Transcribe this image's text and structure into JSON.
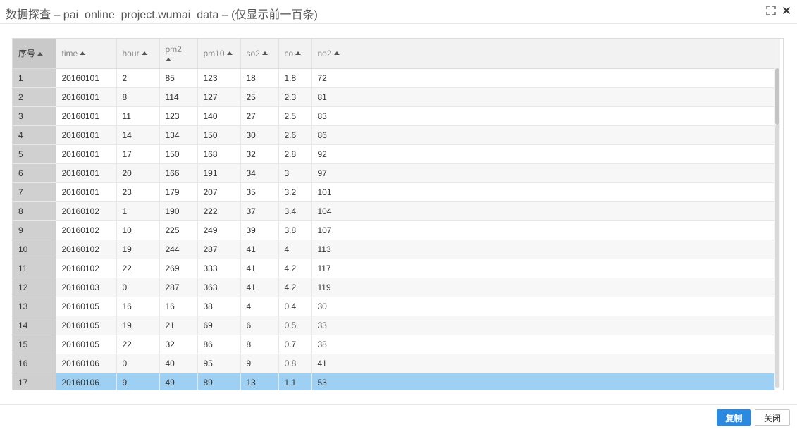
{
  "window": {
    "title": "数据探查 – pai_online_project.wumai_data – (仅显示前一百条)",
    "expand_icon": "expand-icon",
    "close_icon": "close-icon"
  },
  "table": {
    "columns": [
      "序号",
      "time",
      "hour",
      "pm2",
      "pm10",
      "so2",
      "co",
      "no2"
    ],
    "rows": [
      [
        "1",
        "20160101",
        "2",
        "85",
        "123",
        "18",
        "1.8",
        "72"
      ],
      [
        "2",
        "20160101",
        "8",
        "114",
        "127",
        "25",
        "2.3",
        "81"
      ],
      [
        "3",
        "20160101",
        "11",
        "123",
        "140",
        "27",
        "2.5",
        "83"
      ],
      [
        "4",
        "20160101",
        "14",
        "134",
        "150",
        "30",
        "2.6",
        "86"
      ],
      [
        "5",
        "20160101",
        "17",
        "150",
        "168",
        "32",
        "2.8",
        "92"
      ],
      [
        "6",
        "20160101",
        "20",
        "166",
        "191",
        "34",
        "3",
        "97"
      ],
      [
        "7",
        "20160101",
        "23",
        "179",
        "207",
        "35",
        "3.2",
        "101"
      ],
      [
        "8",
        "20160102",
        "1",
        "190",
        "222",
        "37",
        "3.4",
        "104"
      ],
      [
        "9",
        "20160102",
        "10",
        "225",
        "249",
        "39",
        "3.8",
        "107"
      ],
      [
        "10",
        "20160102",
        "19",
        "244",
        "287",
        "41",
        "4",
        "113"
      ],
      [
        "11",
        "20160102",
        "22",
        "269",
        "333",
        "41",
        "4.2",
        "117"
      ],
      [
        "12",
        "20160103",
        "0",
        "287",
        "363",
        "41",
        "4.2",
        "119"
      ],
      [
        "13",
        "20160105",
        "16",
        "16",
        "38",
        "4",
        "0.4",
        "30"
      ],
      [
        "14",
        "20160105",
        "19",
        "21",
        "69",
        "6",
        "0.5",
        "33"
      ],
      [
        "15",
        "20160105",
        "22",
        "32",
        "86",
        "8",
        "0.7",
        "38"
      ],
      [
        "16",
        "20160106",
        "0",
        "40",
        "95",
        "9",
        "0.8",
        "41"
      ],
      [
        "17",
        "20160106",
        "9",
        "49",
        "89",
        "13",
        "1.1",
        "53"
      ]
    ],
    "selected_row": "17",
    "sort_icon": "sort-asc-icon"
  },
  "footer": {
    "copy_label": "复制",
    "close_label": "关闭"
  },
  "colors": {
    "accent": "#2b8ae0",
    "selected_row": "#9ed0f3",
    "index_column": "#d0d0d0"
  }
}
